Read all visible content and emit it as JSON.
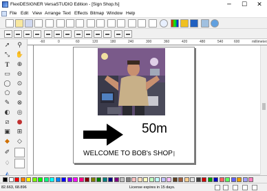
{
  "window": {
    "title": "FlexiDESIGNER VersaSTUDIO Edition - [Sign Shop.fs]",
    "minimize": "─",
    "maximize": "☐",
    "close": "✕"
  },
  "menu": [
    "File",
    "Edit",
    "View",
    "Arrange",
    "Text",
    "Effects",
    "Bitmap",
    "Window",
    "Help"
  ],
  "ruler": {
    "top_labels": [
      "-60",
      "0",
      "60",
      "120",
      "180",
      "240",
      "300",
      "360",
      "420",
      "480",
      "540",
      "600",
      "660",
      "720"
    ],
    "unit": "millimeters",
    "left_labels": [
      "120",
      "60",
      "0",
      "-60",
      "-120",
      "-180",
      "-240"
    ]
  },
  "design": {
    "size_text": "50m",
    "welcome_text": "WELCOME TO BOB's SHOP",
    "cursor": "|"
  },
  "palette": {
    "colors": [
      "#000000",
      "#ffffff",
      "#ff0000",
      "#ff8000",
      "#ffff00",
      "#80ff00",
      "#00ff00",
      "#00ff80",
      "#00ffff",
      "#0080ff",
      "#0000ff",
      "#8000ff",
      "#ff00ff",
      "#ff0080",
      "#800000",
      "#808000",
      "#008000",
      "#008080",
      "#000080",
      "#800080",
      "#c0c0c0",
      "#808080",
      "#ffc0c0",
      "#ffe0c0",
      "#ffffc0",
      "#c0ffc0",
      "#c0ffff",
      "#c0c0ff",
      "#ffc0ff",
      "#604020",
      "#a06040",
      "#ffd090",
      "#e0e0e0",
      "#404040",
      "#d00000",
      "#00a000",
      "#0000c0",
      "#ff6060",
      "#60ff60",
      "#6060ff",
      "#f0a000",
      "#a0a0ff",
      "#ff80c0"
    ]
  },
  "status": {
    "coords": "82.663,   68.896",
    "license": "License expires in 15 days."
  },
  "colors": {
    "accent": "#0078d7"
  }
}
